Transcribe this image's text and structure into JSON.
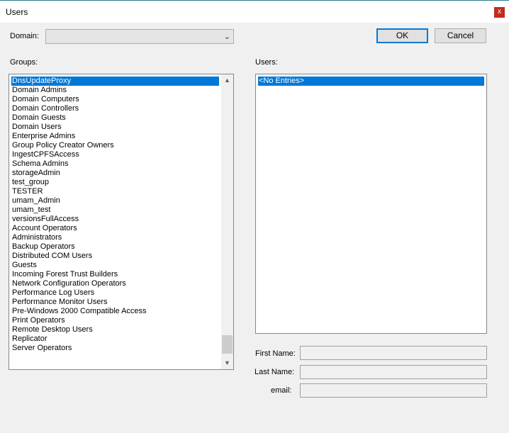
{
  "window": {
    "title": "Users",
    "close_label": "x"
  },
  "domain": {
    "label": "Domain:",
    "value": ""
  },
  "buttons": {
    "ok": "OK",
    "cancel": "Cancel"
  },
  "groups": {
    "label": "Groups:",
    "items": [
      "DnsUpdateProxy",
      "Domain Admins",
      "Domain Computers",
      "Domain Controllers",
      "Domain Guests",
      "Domain Users",
      "Enterprise Admins",
      "Group Policy Creator Owners",
      "IngestCPFSAccess",
      "Schema Admins",
      "storageAdmin",
      "test_group",
      "TESTER",
      "umam_Admin",
      "umam_test",
      "versionsFullAccess",
      "Account Operators",
      "Administrators",
      "Backup Operators",
      "Distributed COM Users",
      "Guests",
      "Incoming Forest Trust Builders",
      "Network Configuration Operators",
      "Performance Log Users",
      "Performance Monitor Users",
      "Pre-Windows 2000 Compatible Access",
      "Print Operators",
      "Remote Desktop Users",
      "Replicator",
      "Server Operators"
    ],
    "selected_index": 0
  },
  "users": {
    "label": "Users:",
    "items": [
      "<No Entries>"
    ],
    "selected_index": 0
  },
  "details": {
    "first_name_label": "First Name:",
    "last_name_label": "Last Name:",
    "email_label": "email:",
    "first_name": "",
    "last_name": "",
    "email": ""
  },
  "icons": {
    "combo_arrow": "chevron-down-icon",
    "scroll_up": "triangle-up-icon",
    "scroll_down": "triangle-down-icon"
  },
  "colors": {
    "selection": "#0078d7",
    "close": "#c42b1c"
  }
}
